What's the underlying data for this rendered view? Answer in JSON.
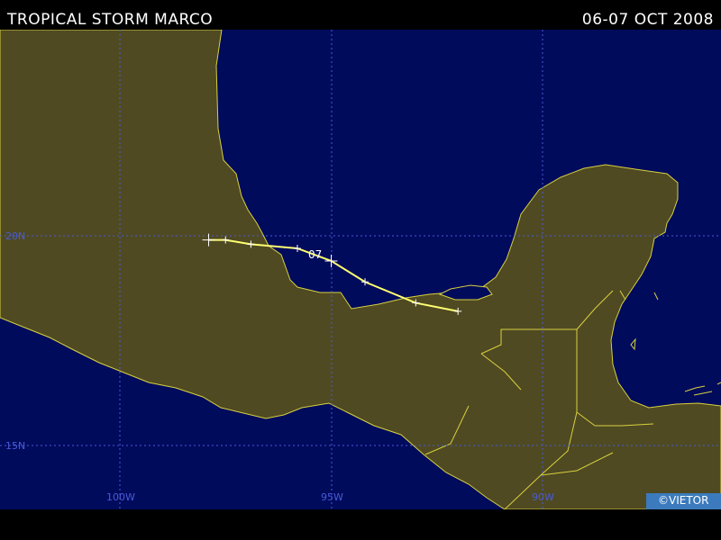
{
  "header": {
    "title": "TROPICAL STORM MARCO",
    "dates": "06-07 OCT 2008"
  },
  "map": {
    "colors": {
      "ocean": "#000b5c",
      "land": "#4f4a22",
      "coast": "#d8d040",
      "grid": "#4a5ad8",
      "track": "#ffff70"
    },
    "grid_labels": {
      "lat_20": "20N",
      "lat_15": "15N",
      "lon_100": "100W",
      "lon_95": "95W",
      "lon_90": "90W"
    },
    "track_labels": {
      "day": "07"
    },
    "track_points": [
      {
        "lon": -97.9,
        "lat": 19.9
      },
      {
        "lon": -97.5,
        "lat": 19.9
      },
      {
        "lon": -96.9,
        "lat": 19.8
      },
      {
        "lon": -95.8,
        "lat": 19.7
      },
      {
        "lon": -95.0,
        "lat": 19.4
      },
      {
        "lon": -94.2,
        "lat": 18.9
      },
      {
        "lon": -93.0,
        "lat": 18.4
      },
      {
        "lon": -92.0,
        "lat": 18.2
      }
    ]
  },
  "credit": "©VIETOR"
}
